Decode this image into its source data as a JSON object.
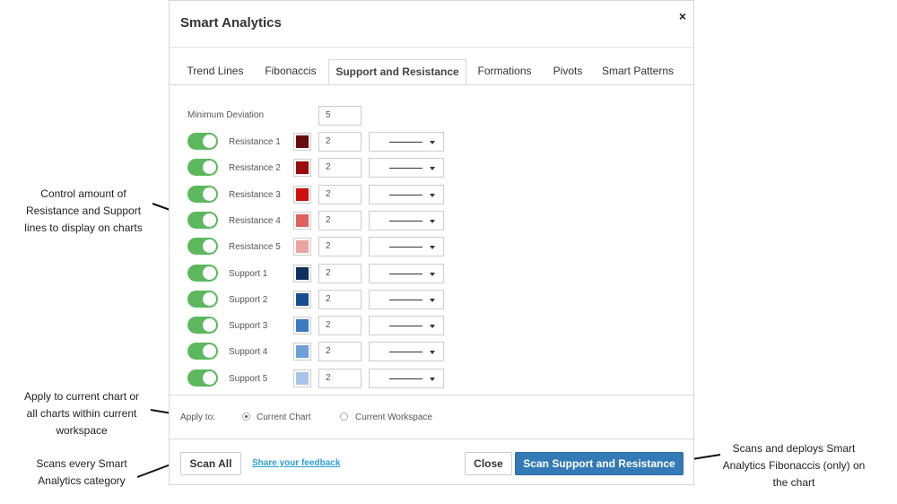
{
  "dialog": {
    "title": "Smart Analytics",
    "close_glyph": "×",
    "tabs": [
      {
        "label": "Trend Lines",
        "active": false
      },
      {
        "label": "Fibonaccis",
        "active": false
      },
      {
        "label": "Support and Resistance",
        "active": true
      },
      {
        "label": "Formations",
        "active": false
      },
      {
        "label": "Pivots",
        "active": false
      },
      {
        "label": "Smart Patterns",
        "active": false
      }
    ],
    "min_deviation": {
      "label": "Minimum Deviation",
      "value": "5"
    },
    "rows": [
      {
        "label": "Resistance 1",
        "enabled": true,
        "color": "#6b0a0a",
        "width": "2"
      },
      {
        "label": "Resistance 2",
        "enabled": true,
        "color": "#9b0c0c",
        "width": "2"
      },
      {
        "label": "Resistance 3",
        "enabled": true,
        "color": "#cc1010",
        "width": "2"
      },
      {
        "label": "Resistance 4",
        "enabled": true,
        "color": "#e06060",
        "width": "2"
      },
      {
        "label": "Resistance 5",
        "enabled": true,
        "color": "#eba39f",
        "width": "2"
      },
      {
        "label": "Support 1",
        "enabled": true,
        "color": "#0d2f5e",
        "width": "2"
      },
      {
        "label": "Support 2",
        "enabled": true,
        "color": "#174e92",
        "width": "2"
      },
      {
        "label": "Support 3",
        "enabled": true,
        "color": "#3a7ac5",
        "width": "2"
      },
      {
        "label": "Support 4",
        "enabled": true,
        "color": "#6e9fd6",
        "width": "2"
      },
      {
        "label": "Support 5",
        "enabled": true,
        "color": "#a8c5e9",
        "width": "2"
      }
    ],
    "apply_to": {
      "label": "Apply to:",
      "options": [
        {
          "label": "Current Chart",
          "checked": true
        },
        {
          "label": "Current Workspace",
          "checked": false
        }
      ]
    },
    "footer": {
      "scan_all": "Scan All",
      "feedback": "Share your feedback",
      "close": "Close",
      "scan": "Scan Support and Resistance"
    }
  },
  "annotations": {
    "toggles": [
      "Control amount of",
      "Resistance and Support",
      "lines to display on charts"
    ],
    "apply": [
      "Apply to current chart or",
      "all charts within current",
      "workspace"
    ],
    "scan_all": [
      "Scans every Smart",
      "Analytics category"
    ],
    "scan": [
      "Scans and deploys Smart",
      "Analytics Fibonaccis (only) on",
      "the chart"
    ]
  },
  "colors": {
    "toggle_on": "#5cb85c",
    "primary": "#337ab7",
    "link": "#2a9fd6"
  }
}
